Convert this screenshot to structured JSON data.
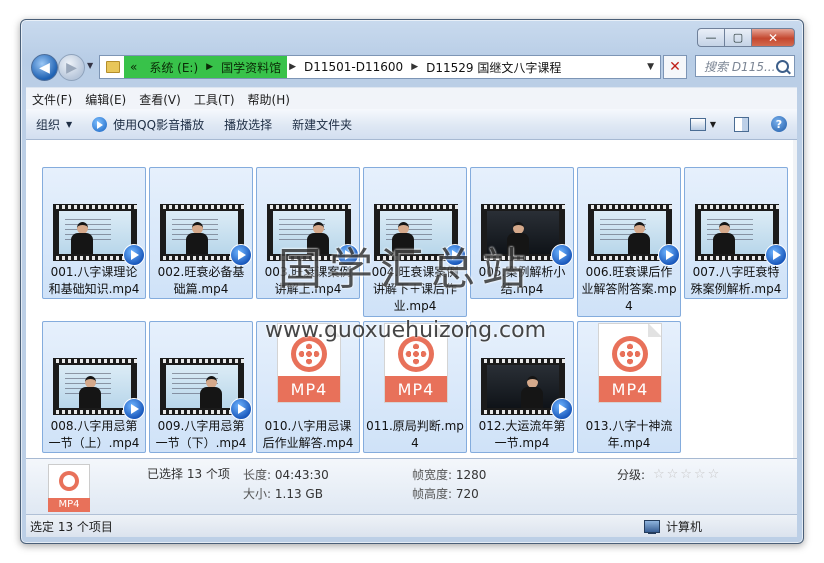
{
  "window": {
    "caption": {
      "minimize": "—",
      "maximize": "▢",
      "close": "✕"
    }
  },
  "address": {
    "overflow": "«",
    "crumbs": [
      "系统 (E:)",
      "国学资料馆",
      "D11501-D11600",
      "D11529 国继文八字课程"
    ],
    "search_placeholder": "搜索 D115..."
  },
  "menu": [
    "文件(F)",
    "编辑(E)",
    "查看(V)",
    "工具(T)",
    "帮助(H)"
  ],
  "toolbar": {
    "organize": "组织",
    "play_qq": "使用QQ影音播放",
    "play_selected": "播放选择",
    "new_folder": "新建文件夹"
  },
  "files": [
    {
      "name": "001.八字课理论和基础知识.mp4",
      "kind": "thumb",
      "screen": "light"
    },
    {
      "name": "002.旺衰必备基础篇.mp4",
      "kind": "thumb",
      "screen": "light"
    },
    {
      "name": "003.旺衰课案例讲解上.mp4",
      "kind": "thumb",
      "screen": "light"
    },
    {
      "name": "004.旺衰课案例讲解下＋课后作业.mp4",
      "kind": "thumb",
      "screen": "light"
    },
    {
      "name": "005.案例解析小结.mp4",
      "kind": "thumb",
      "screen": "dark"
    },
    {
      "name": "006.旺衰课后作业解答附答案.mp4",
      "kind": "thumb",
      "screen": "light"
    },
    {
      "name": "007.八字旺衰特殊案例解析.mp4",
      "kind": "thumb",
      "screen": "light"
    },
    {
      "name": "008.八字用忌第一节（上）.mp4",
      "kind": "thumb",
      "screen": "light"
    },
    {
      "name": "009.八字用忌第一节（下）.mp4",
      "kind": "thumb",
      "screen": "light"
    },
    {
      "name": "010.八字用忌课后作业解答.mp4",
      "kind": "mp4icon"
    },
    {
      "name": "011.原局判断.mp4",
      "kind": "mp4icon"
    },
    {
      "name": "012.大运流年第一节.mp4",
      "kind": "thumb",
      "screen": "dark"
    },
    {
      "name": "013.八字十神流年.mp4",
      "kind": "mp4icon"
    }
  ],
  "mp4_badge": "MP4",
  "watermark": {
    "text": "国学汇总站",
    "url": "www.guoxuehuizong.com"
  },
  "details": {
    "selected": "已选择 13 个项",
    "length_label": "长度:",
    "length_value": "04:43:30",
    "size_label": "大小:",
    "size_value": "1.13 GB",
    "width_label": "帧宽度:",
    "width_value": "1280",
    "height_label": "帧高度:",
    "height_value": "720",
    "rating_label": "分级:",
    "rating_stars": "☆☆☆☆☆"
  },
  "status": {
    "left": "选定 13 个项目",
    "right": "计算机"
  }
}
